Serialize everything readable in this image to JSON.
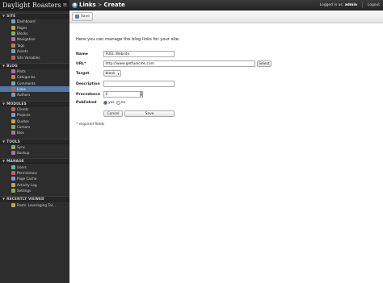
{
  "app": {
    "title": "Daylight Roasters",
    "menu_glyph": "≡"
  },
  "header": {
    "breadcrumb_parent": "Links",
    "breadcrumb_sep": ">",
    "breadcrumb_current": "Create",
    "logged_in_label": "Logged in as:",
    "user": "admin",
    "logout": "Logout"
  },
  "toolbar": {
    "save_label": "Save"
  },
  "sidebar": {
    "sections": [
      {
        "label": "SITE",
        "items": [
          "Dashboard",
          "Pages",
          "Blocks",
          "Navigation",
          "Tags",
          "Assets",
          "Site Variables"
        ]
      },
      {
        "label": "BLOG",
        "items": [
          "Posts",
          "Categories",
          "Comments",
          "Links",
          "Authors"
        ]
      },
      {
        "label": "MODULES",
        "items": [
          "Clients",
          "Projects",
          "Quotes",
          "Careers",
          "Bios"
        ]
      },
      {
        "label": "TOOLS",
        "items": [
          "Sync",
          "Backup"
        ]
      },
      {
        "label": "MANAGE",
        "items": [
          "Users",
          "Permissions",
          "Page Cache",
          "Activity Log",
          "Settings"
        ]
      },
      {
        "label": "RECENTLY VIEWED",
        "items": [
          "Posts: Leveraging Tal..."
        ]
      }
    ],
    "active_item": "Links"
  },
  "form": {
    "intro": "Here you can manage the blog links for your site.",
    "name_label": "Name",
    "name_value": "FUEL Website",
    "url_label": "URL*",
    "url_value": "http://www.getfuelcms.com",
    "url_select": "Select",
    "target_label": "Target",
    "target_value": "blank",
    "description_label": "Description",
    "description_value": "",
    "precedence_label": "Precedence",
    "precedence_value": "0",
    "published_label": "Published",
    "published_yes": "yes",
    "published_no": "no",
    "cancel_label": "Cancel",
    "save_label": "Save",
    "required_note": "* required fields"
  },
  "colors": {
    "sidebar_bg": "#2d2d2d",
    "active_item": "#4f78a8",
    "accent": "#4f8fd0"
  },
  "icons": {
    "save": "save-icon",
    "logo": "fuel-logo-icon",
    "menu": "menu-icon"
  }
}
